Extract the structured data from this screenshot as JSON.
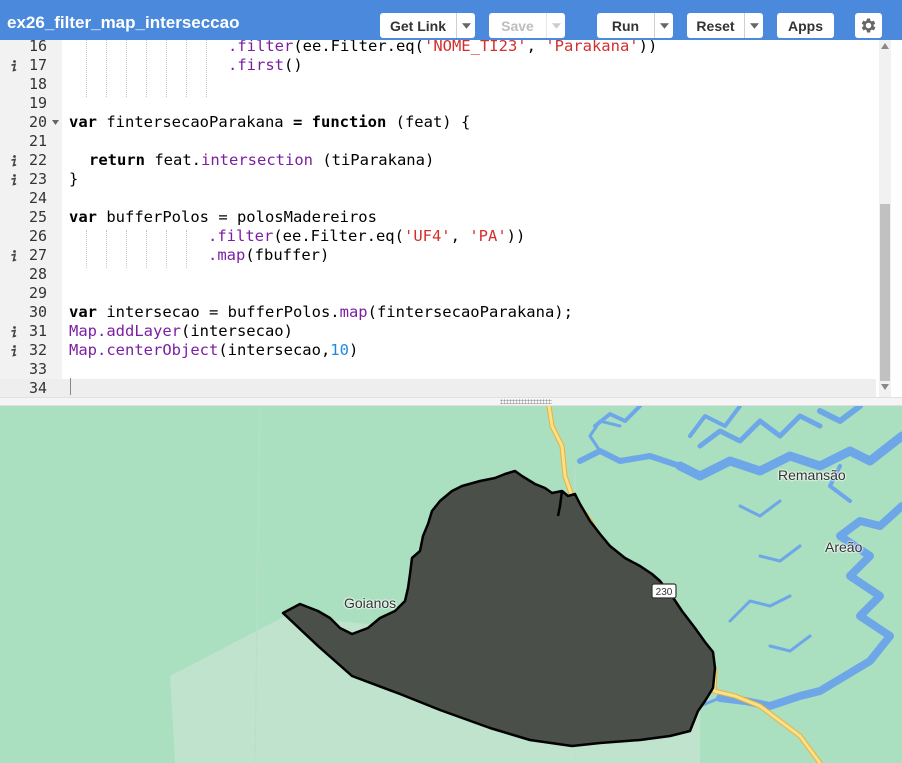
{
  "toolbar": {
    "title": "ex26_filter_map_interseccao",
    "get_link_label": "Get Link",
    "save_label": "Save",
    "run_label": "Run",
    "reset_label": "Reset",
    "apps_label": "Apps",
    "settings_icon": "gear-icon",
    "background_color": "#4a89dc"
  },
  "editor": {
    "lines": [
      {
        "n": "16",
        "info": false,
        "fold": false
      },
      {
        "n": "17",
        "info": true,
        "fold": false
      },
      {
        "n": "18",
        "info": false,
        "fold": false
      },
      {
        "n": "19",
        "info": false,
        "fold": false
      },
      {
        "n": "20",
        "info": false,
        "fold": true
      },
      {
        "n": "21",
        "info": false,
        "fold": false
      },
      {
        "n": "22",
        "info": true,
        "fold": false
      },
      {
        "n": "23",
        "info": true,
        "fold": false
      },
      {
        "n": "24",
        "info": false,
        "fold": false
      },
      {
        "n": "25",
        "info": false,
        "fold": false
      },
      {
        "n": "26",
        "info": false,
        "fold": false
      },
      {
        "n": "27",
        "info": true,
        "fold": false
      },
      {
        "n": "28",
        "info": false,
        "fold": false
      },
      {
        "n": "29",
        "info": false,
        "fold": false
      },
      {
        "n": "30",
        "info": false,
        "fold": false
      },
      {
        "n": "31",
        "info": true,
        "fold": false
      },
      {
        "n": "32",
        "info": true,
        "fold": false
      },
      {
        "n": "33",
        "info": false,
        "fold": false
      },
      {
        "n": "34",
        "info": false,
        "fold": false,
        "active": true
      }
    ],
    "code": {
      "l16": [
        ".filter",
        "(ee.Filter.eq(",
        "'NOME_TI23'",
        ", ",
        "'Parakana'",
        "))"
      ],
      "l17": [
        ".first",
        "()"
      ],
      "l20": [
        "var",
        " fintersecaoParakana ",
        "=",
        " ",
        "function",
        " (feat) {"
      ],
      "l22": [
        "return",
        " feat.",
        "intersection",
        " (tiParakana)"
      ],
      "l23": "}",
      "l25": [
        "var",
        " bufferPolos = polosMadereiros"
      ],
      "l26": [
        ".filter",
        "(ee.Filter.eq(",
        "'UF4'",
        ", ",
        "'PA'",
        "))"
      ],
      "l27": [
        ".map",
        "(fbuffer)"
      ],
      "l30": [
        "var",
        " intersecao = bufferPolos.",
        "map",
        "(fintersecaoParakana);"
      ],
      "l31": [
        "Map.addLayer",
        "(intersecao)"
      ],
      "l32": [
        "Map.centerObject",
        "(intersecao,",
        "10",
        ")"
      ]
    },
    "colors": {
      "keyword": "#000000",
      "function": "#7b1fa2",
      "string": "#d32f2f",
      "number": "#1e88e5"
    }
  },
  "map": {
    "places": {
      "remansao": "Remansão",
      "areao": "Areão",
      "goianos": "Goianos"
    },
    "road_shield": "230",
    "colors": {
      "land": "#aadfc0",
      "water": "#6ea7e8",
      "road": "#f5c542",
      "polygon_fill": "#4a4f49",
      "polygon_stroke": "#000000"
    }
  }
}
